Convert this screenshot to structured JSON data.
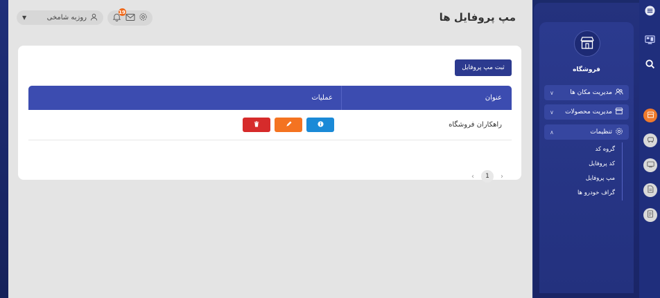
{
  "header": {
    "title": "مپ پروفایل ها",
    "user_name": "روزبه شامخی",
    "notification_count": "19"
  },
  "toolbar": {
    "add_label": "ثبت مپ پروفایل"
  },
  "table": {
    "columns": [
      "عنوان",
      "عملیات"
    ],
    "rows": [
      {
        "title": "راهکاران فروشگاه"
      }
    ]
  },
  "pagination": {
    "current_page": "1"
  },
  "sidebar": {
    "section_label": "فروشگاه",
    "items": [
      {
        "label": "مدیریت مکان ها",
        "icon": "users-icon",
        "expanded": false
      },
      {
        "label": "مدیریت محصولات",
        "icon": "store-icon",
        "expanded": false
      },
      {
        "label": "تنظیمات",
        "icon": "gear-icon",
        "expanded": true
      }
    ],
    "subitems": [
      "گروه کد",
      "کد پروفایل",
      "مپ پروفایل",
      "گراف خودرو ها"
    ]
  },
  "colors": {
    "primary": "#2c3a8f",
    "table_header": "#3c4cb0",
    "info": "#1b8ad7",
    "edit": "#f47321",
    "delete": "#d62b2b",
    "badge": "#ef6a1c"
  }
}
